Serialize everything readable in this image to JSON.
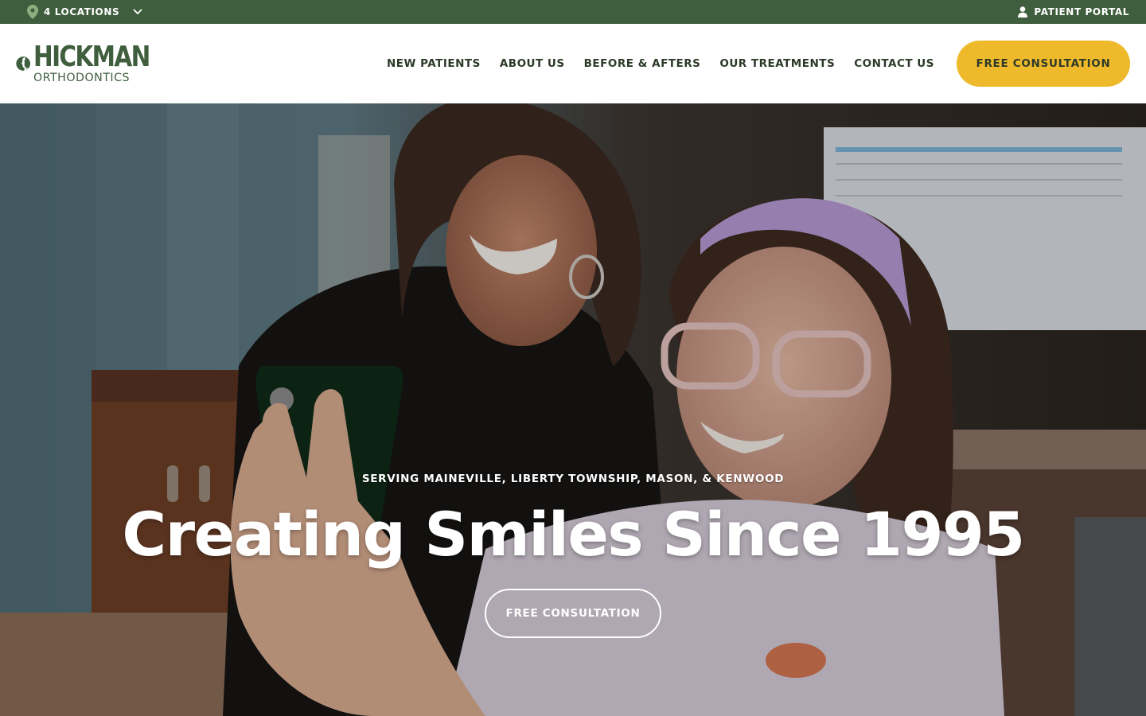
{
  "topbar": {
    "locations_label": "4 LOCATIONS",
    "portal_label": "PATIENT PORTAL"
  },
  "brand": {
    "name": "HICKMAN",
    "tagline": "ORTHODONTICS",
    "color": "#3f5e3d"
  },
  "nav": {
    "items": [
      "NEW PATIENTS",
      "ABOUT US",
      "BEFORE & AFTERS",
      "OUR TREATMENTS",
      "CONTACT US"
    ],
    "cta_label": "FREE CONSULTATION",
    "cta_color": "#eeba2c"
  },
  "hero": {
    "eyebrow": "SERVING MAINEVILLE, LIBERTY TOWNSHIP, MASON, & KENWOOD",
    "title": "Creating Smiles Since 1995",
    "button_label": "FREE CONSULTATION",
    "image": "orthodontist-and-patient-taking-selfie-photo"
  },
  "icons": {
    "location": "map-pin-icon",
    "dropdown": "chevron-down-icon",
    "portal": "user-icon"
  }
}
